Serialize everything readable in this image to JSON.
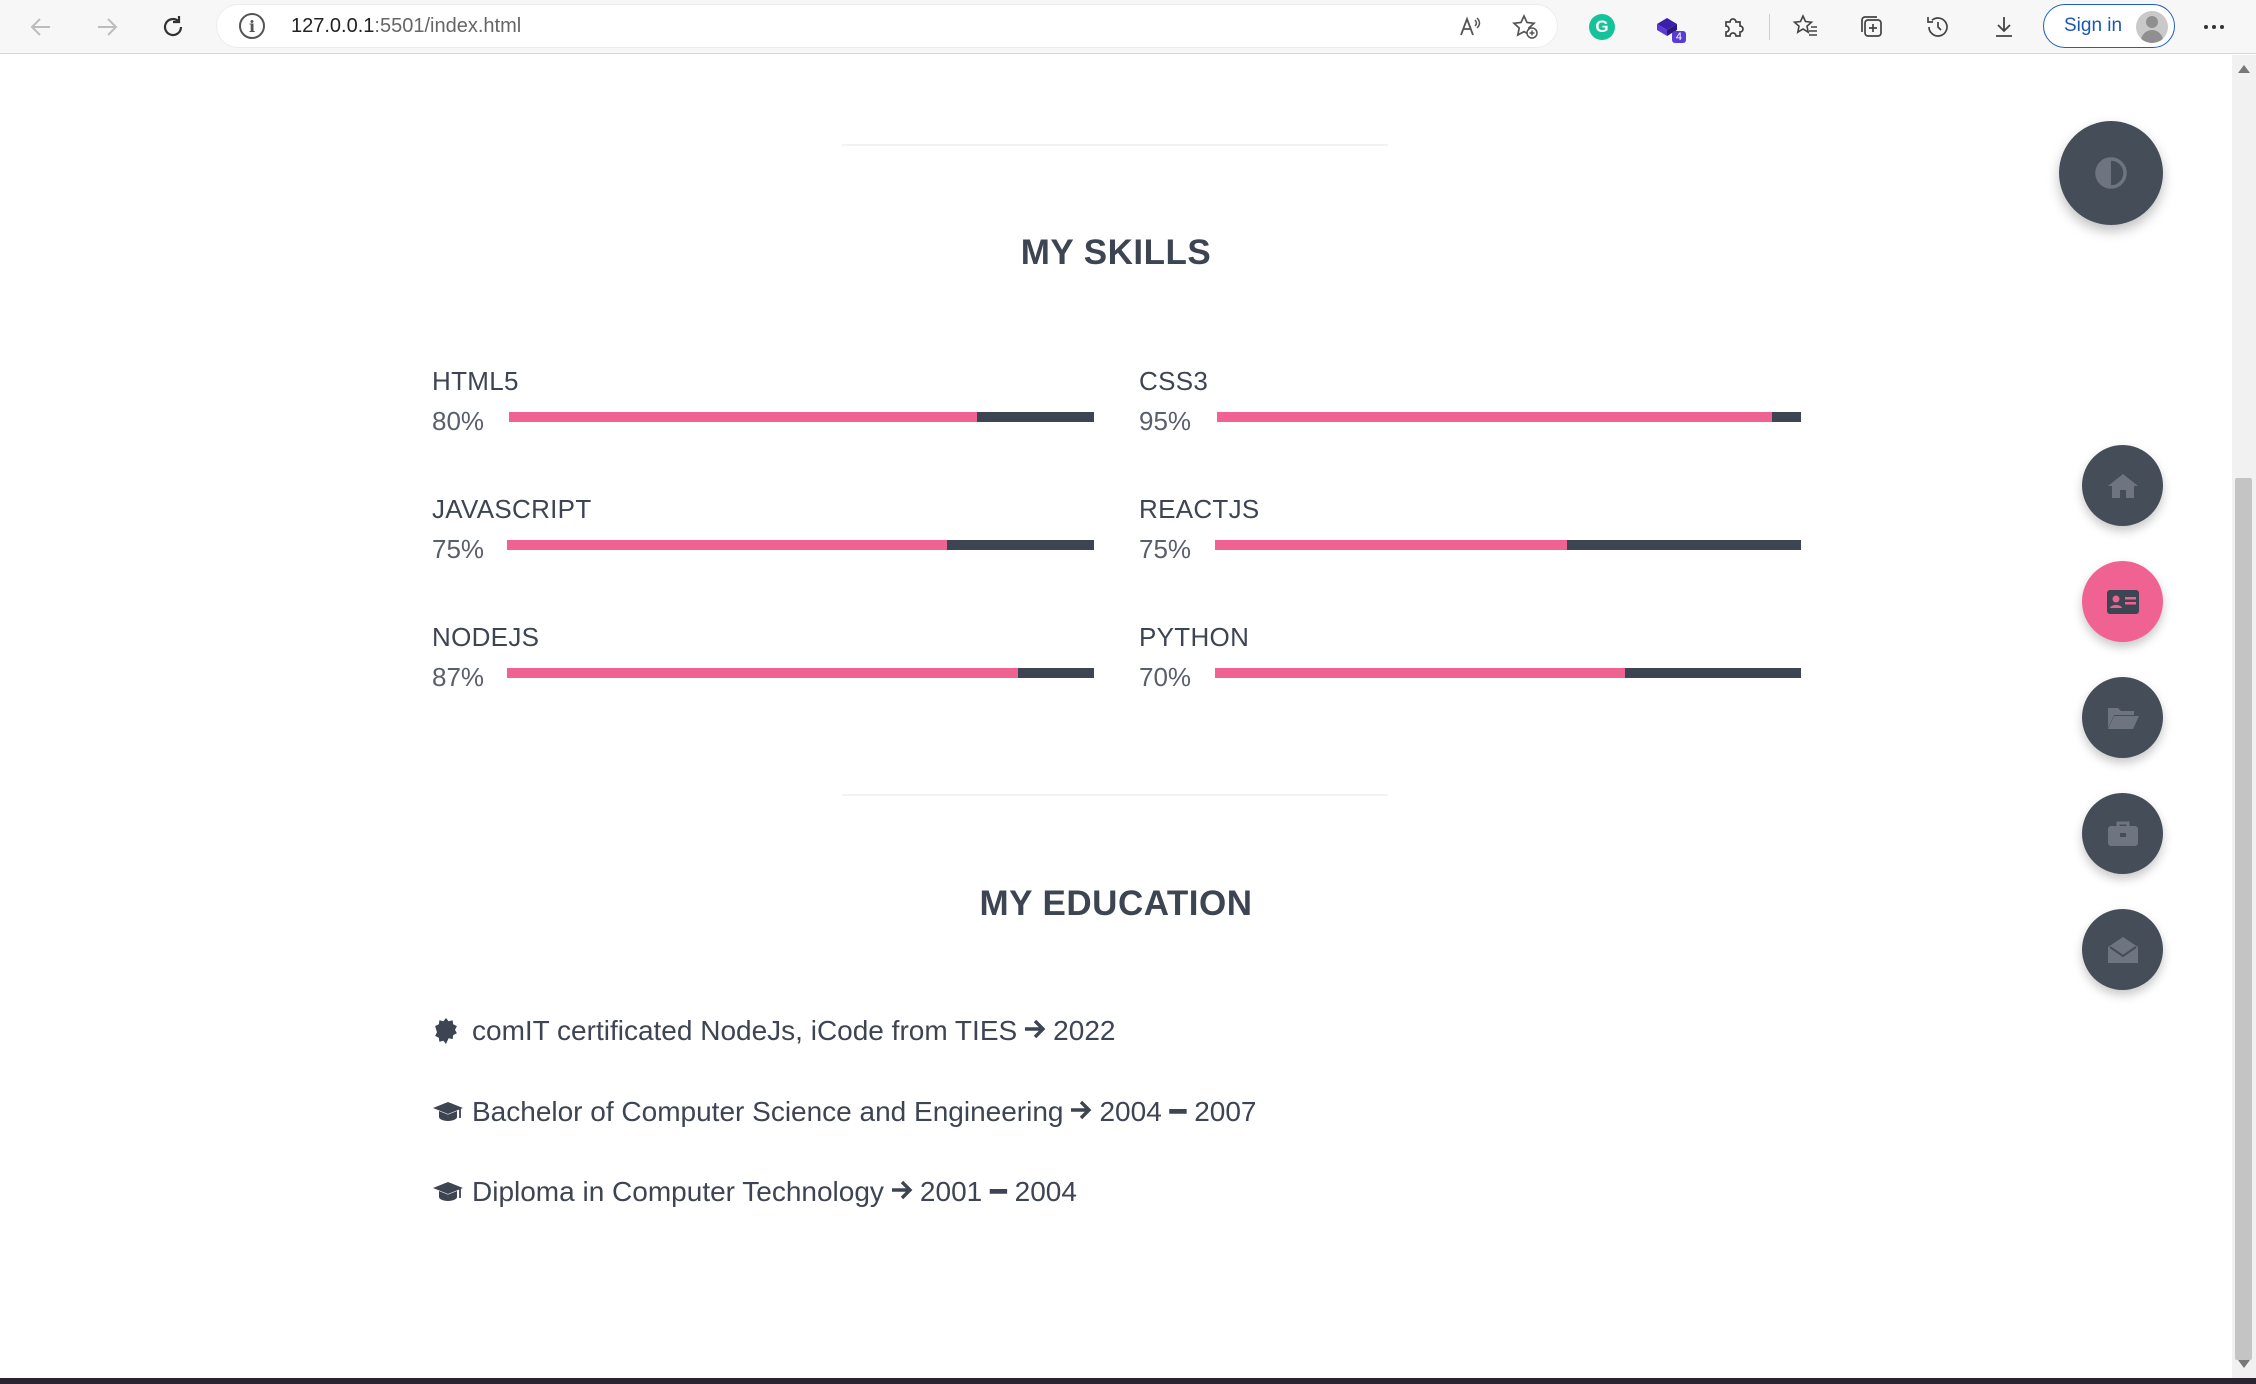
{
  "browser": {
    "url_host": "127.0.0.1",
    "url_rest": ":5501/index.html",
    "sign_in_label": "Sign in",
    "extension_badge": "4"
  },
  "colors": {
    "accent": "#f06292",
    "dark": "#3d4452",
    "fab": "#454d59"
  },
  "skills_section": {
    "title": "MY SKILLS",
    "items": [
      {
        "name": "HTML5",
        "percent_label": "80%",
        "level": 0.8
      },
      {
        "name": "CSS3",
        "percent_label": "95%",
        "level": 0.95
      },
      {
        "name": "JAVASCRIPT",
        "percent_label": "75%",
        "level": 0.75
      },
      {
        "name": "REACTJS",
        "percent_label": "75%",
        "level": 0.6
      },
      {
        "name": "NODEJS",
        "percent_label": "87%",
        "level": 0.87
      },
      {
        "name": "PYTHON",
        "percent_label": "70%",
        "level": 0.7
      }
    ]
  },
  "education_section": {
    "title": "MY EDUCATION",
    "items": [
      {
        "icon": "certificate-icon",
        "text": "comIT certificated NodeJs, iCode from TIES",
        "years": "2022"
      },
      {
        "icon": "graduation-cap-icon",
        "text": "Bachelor of Computer Science and Engineering",
        "years": "2004 ━ 2007"
      },
      {
        "icon": "graduation-cap-icon",
        "text": "Diploma in Computer Technology",
        "years": "2001 ━ 2004"
      }
    ]
  },
  "floating_nav": [
    {
      "name": "home",
      "icon": "home-icon",
      "active": false
    },
    {
      "name": "about",
      "icon": "id-card-icon",
      "active": true
    },
    {
      "name": "portfolio",
      "icon": "folder-open-icon",
      "active": false
    },
    {
      "name": "experience",
      "icon": "briefcase-icon",
      "active": false
    },
    {
      "name": "contact",
      "icon": "envelope-open-icon",
      "active": false
    }
  ],
  "theme_toggle": {
    "icon": "contrast-icon"
  }
}
